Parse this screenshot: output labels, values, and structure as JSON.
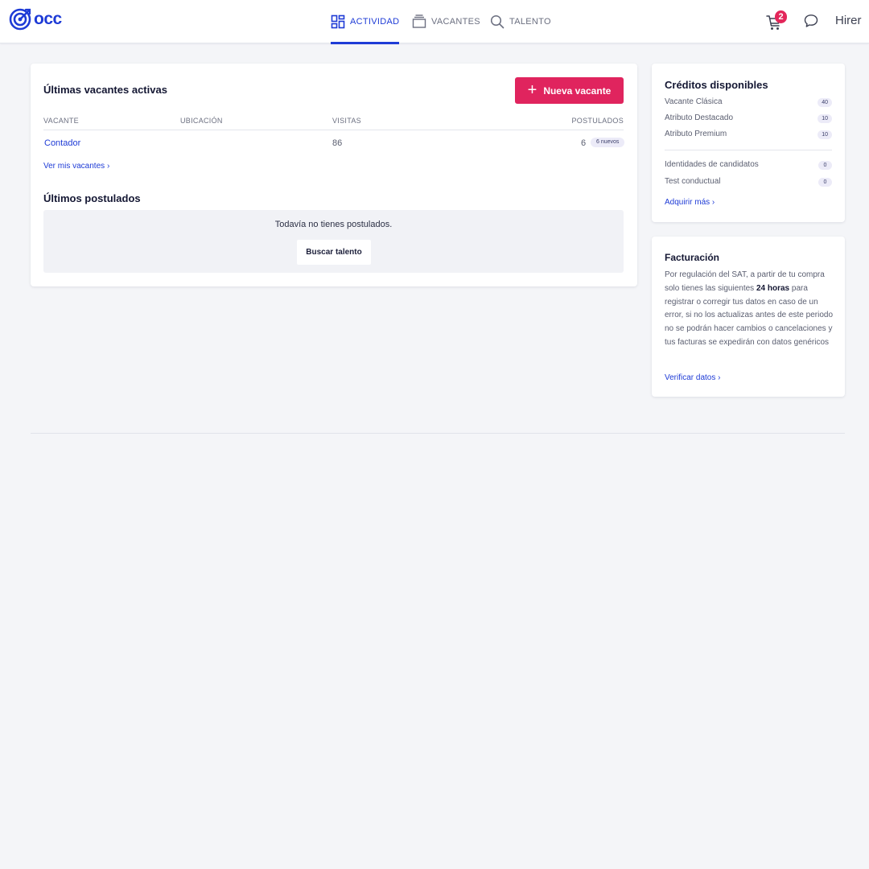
{
  "brand": {
    "name": "occ",
    "color": "#1e3bd6"
  },
  "nav": {
    "items": [
      {
        "label": "ACTIVIDAD",
        "icon": "dashboard-icon",
        "active": true
      },
      {
        "label": "VACANTES",
        "icon": "vacancies-icon",
        "active": false
      },
      {
        "label": "TALENTO",
        "icon": "search-icon",
        "active": false
      }
    ]
  },
  "header": {
    "cart_count": "2",
    "user_name": "Hirer"
  },
  "vacancies": {
    "title": "Últimas vacantes activas",
    "new_button": "Nueva vacante",
    "columns": [
      "VACANTE",
      "UBICACIÓN",
      "VISITAS",
      "POSTULADOS"
    ],
    "rows": [
      {
        "vacante": "Contador",
        "ubicacion": "",
        "visitas": "86",
        "postulados": "6",
        "nuevos": "6 nuevos"
      }
    ],
    "see_all": "Ver mis vacantes"
  },
  "applicants": {
    "title": "Últimos postulados",
    "empty_text": "Todavía no tienes postulados.",
    "search_button": "Buscar talento"
  },
  "credits": {
    "title": "Créditos disponibles",
    "items": [
      {
        "label": "Vacante Clásica",
        "value": "40"
      },
      {
        "label": "Atributo Destacado",
        "value": "10"
      },
      {
        "label": "Atributo Premium",
        "value": "10"
      }
    ],
    "extra": [
      {
        "label": "Identidades de candidatos",
        "value": "0"
      },
      {
        "label": "Test conductual",
        "value": "0"
      }
    ],
    "acquire": "Adquirir más"
  },
  "billing": {
    "title": "Facturación",
    "text_before": "Por regulación del SAT, a partir de tu compra solo tienes las siguientes ",
    "text_bold": "24 horas",
    "text_after": " para registrar o corregir tus datos en caso de un error, si no los actualizas antes de este periodo no se podrán hacer cambios o cancelaciones y tus facturas se expedirán con datos genéricos",
    "verify": "Verificar datos"
  },
  "colors": {
    "accent": "#1e3bd6",
    "primary_button": "#e0245e",
    "badge": "#e3265a"
  }
}
